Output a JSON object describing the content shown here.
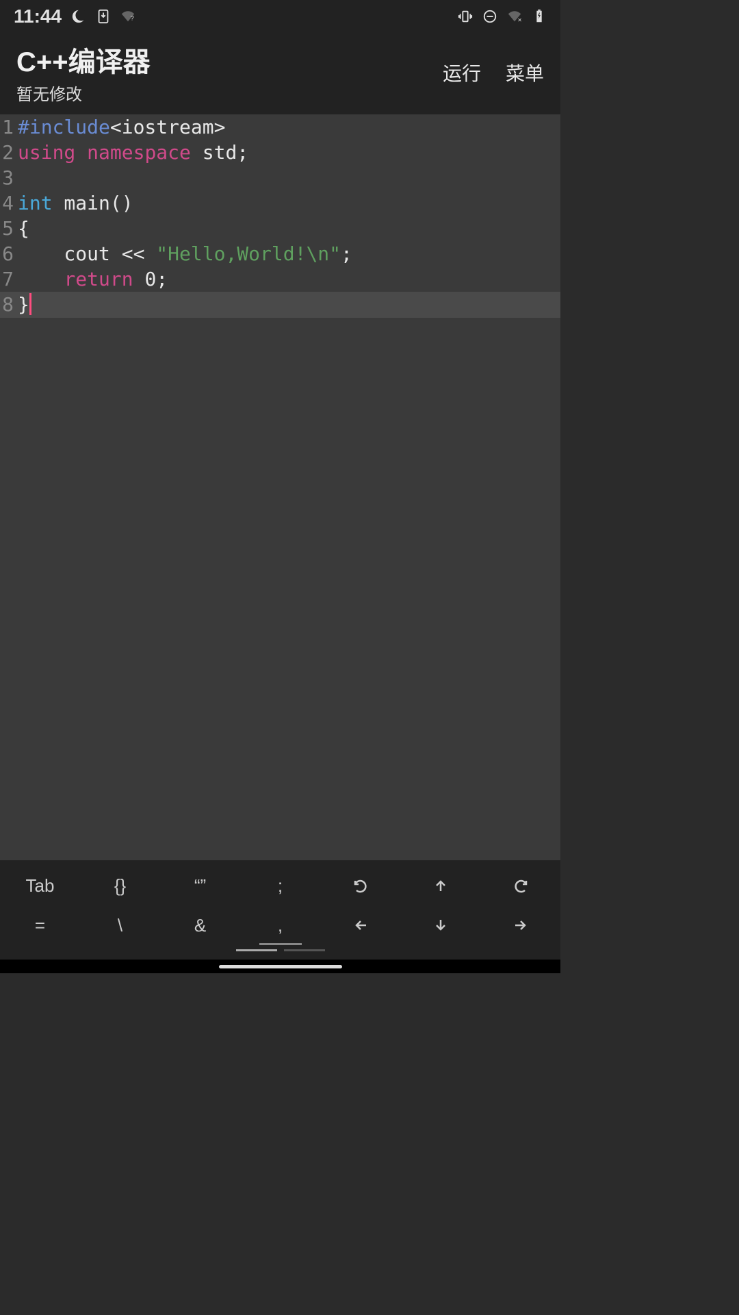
{
  "status": {
    "time": "11:44",
    "icons_left": [
      "moon-icon",
      "download-icon",
      "wifi-weak-icon"
    ],
    "icons_right": [
      "vibrate-icon",
      "dnd-icon",
      "wifi-off-icon",
      "battery-charging-icon"
    ]
  },
  "header": {
    "title": "C++编译器",
    "subtitle": "暂无修改",
    "run_label": "运行",
    "menu_label": "菜单"
  },
  "editor": {
    "cursor_line": 8,
    "lines": [
      {
        "n": 1,
        "tokens": [
          {
            "t": "preproc",
            "v": "#include"
          },
          {
            "t": "plain",
            "v": "<iostream>"
          }
        ]
      },
      {
        "n": 2,
        "tokens": [
          {
            "t": "keyword",
            "v": "using"
          },
          {
            "t": "plain",
            "v": " "
          },
          {
            "t": "keyword",
            "v": "namespace"
          },
          {
            "t": "plain",
            "v": " std;"
          }
        ]
      },
      {
        "n": 3,
        "tokens": []
      },
      {
        "n": 4,
        "tokens": [
          {
            "t": "type",
            "v": "int"
          },
          {
            "t": "plain",
            "v": " main()"
          }
        ]
      },
      {
        "n": 5,
        "tokens": [
          {
            "t": "plain",
            "v": "{"
          }
        ]
      },
      {
        "n": 6,
        "tokens": [
          {
            "t": "plain",
            "v": "    cout << "
          },
          {
            "t": "string",
            "v": "\"Hello,World!\\n\""
          },
          {
            "t": "plain",
            "v": ";"
          }
        ]
      },
      {
        "n": 7,
        "tokens": [
          {
            "t": "plain",
            "v": "    "
          },
          {
            "t": "keyword",
            "v": "return"
          },
          {
            "t": "plain",
            "v": " 0;"
          }
        ]
      },
      {
        "n": 8,
        "tokens": [
          {
            "t": "plain",
            "v": "}"
          }
        ]
      }
    ]
  },
  "toolbar": {
    "row1": [
      {
        "label": "Tab",
        "name": "key-tab",
        "type": "text"
      },
      {
        "label": "{}",
        "name": "key-braces",
        "type": "text"
      },
      {
        "label": "“”",
        "name": "key-quotes",
        "type": "text"
      },
      {
        "label": ";",
        "name": "key-semicolon",
        "type": "text"
      },
      {
        "label": "undo",
        "name": "key-undo",
        "type": "icon"
      },
      {
        "label": "arrow-up",
        "name": "key-up",
        "type": "icon"
      },
      {
        "label": "redo",
        "name": "key-redo",
        "type": "icon"
      }
    ],
    "row2": [
      {
        "label": "=",
        "name": "key-equals",
        "type": "text"
      },
      {
        "label": "\\",
        "name": "key-backslash",
        "type": "text"
      },
      {
        "label": "&",
        "name": "key-amp",
        "type": "text"
      },
      {
        "label": ",",
        "name": "key-comma",
        "type": "text",
        "selected": true
      },
      {
        "label": "arrow-left",
        "name": "key-left",
        "type": "icon"
      },
      {
        "label": "arrow-down",
        "name": "key-down",
        "type": "icon"
      },
      {
        "label": "arrow-right",
        "name": "key-right",
        "type": "icon"
      }
    ],
    "pages": 2,
    "active_page": 0
  }
}
